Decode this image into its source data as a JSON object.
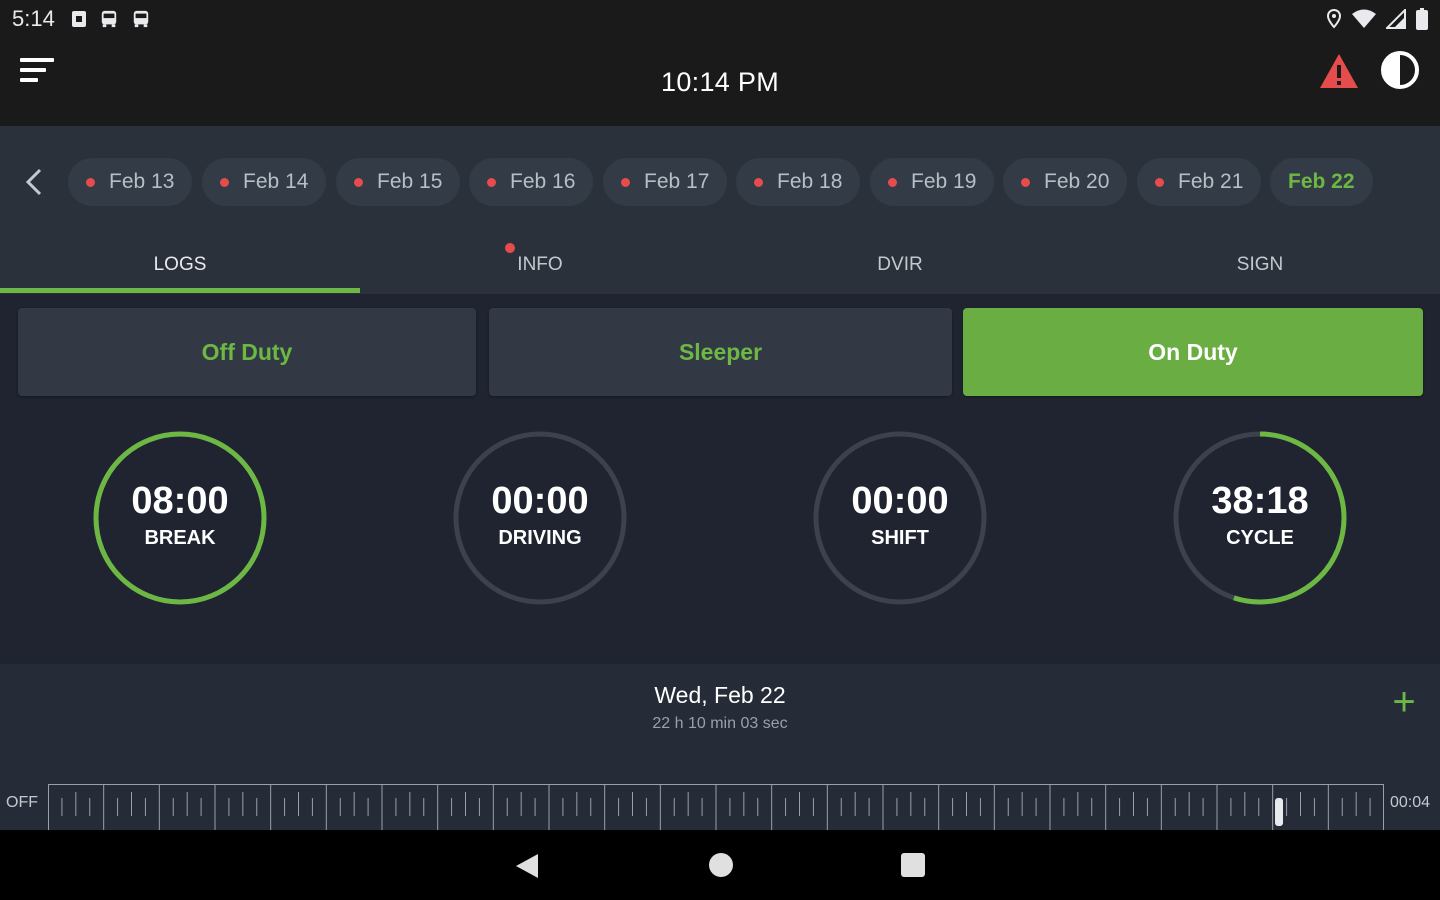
{
  "status_bar": {
    "time": "5:14",
    "icons_left": [
      "sim-icon",
      "bus-icon",
      "bus-icon"
    ],
    "icons_right": [
      "location-icon",
      "wifi-icon",
      "signal-icon",
      "battery-icon"
    ]
  },
  "app_bar": {
    "title": "10:14 PM",
    "menu_icon": "menu-icon",
    "alert_icon": "warning-icon",
    "theme_icon": "contrast-icon"
  },
  "date_strip": {
    "back_icon": "chevron-left-icon",
    "dates": [
      {
        "label": "Feb 13",
        "has_violation": true
      },
      {
        "label": "Feb 14",
        "has_violation": true
      },
      {
        "label": "Feb 15",
        "has_violation": true
      },
      {
        "label": "Feb 16",
        "has_violation": true
      },
      {
        "label": "Feb 17",
        "has_violation": true
      },
      {
        "label": "Feb 18",
        "has_violation": true
      },
      {
        "label": "Feb 19",
        "has_violation": true
      },
      {
        "label": "Feb 20",
        "has_violation": true
      },
      {
        "label": "Feb 21",
        "has_violation": true
      },
      {
        "label": "Feb 22",
        "has_violation": false,
        "active": true
      }
    ]
  },
  "tabs": [
    {
      "label": "LOGS",
      "active": true
    },
    {
      "label": "INFO",
      "has_badge": true
    },
    {
      "label": "DVIR"
    },
    {
      "label": "SIGN"
    }
  ],
  "duty_status": {
    "off_duty": "Off Duty",
    "sleeper": "Sleeper",
    "on_duty": "On Duty",
    "selected": "On Duty"
  },
  "timers": [
    {
      "value": "08:00",
      "label": "BREAK",
      "progress": 1.0
    },
    {
      "value": "00:00",
      "label": "DRIVING",
      "progress": 0.0
    },
    {
      "value": "00:00",
      "label": "SHIFT",
      "progress": 0.0
    },
    {
      "value": "38:18",
      "label": "CYCLE",
      "progress": 0.55
    }
  ],
  "day_summary": {
    "title": "Wed, Feb 22",
    "subtitle": "22 h 10 min 03 sec",
    "add_icon": "plus-icon",
    "row_label": "OFF",
    "row_total": "00:04"
  },
  "colors": {
    "accent": "#6db844",
    "active_button": "#6aad42",
    "violation": "#e74c4c",
    "background": "#1f2430",
    "panel": "#2a313b"
  },
  "nav_bar": {
    "back_icon": "back-triangle-icon",
    "home_icon": "home-circle-icon",
    "recents_icon": "recents-square-icon"
  }
}
